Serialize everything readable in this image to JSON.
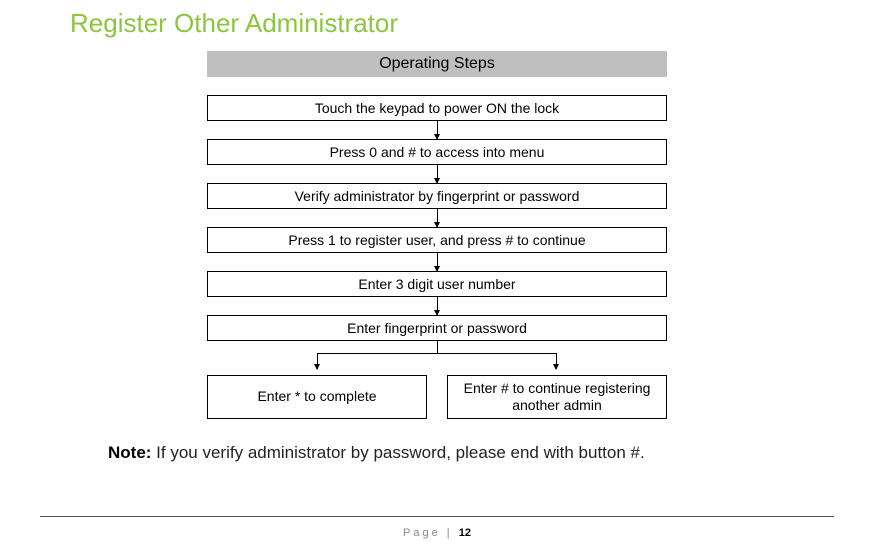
{
  "title": "Register Other Administrator",
  "header": "Operating Steps",
  "steps": [
    "Touch the keypad to power ON the lock",
    "Press  0 and  # to access into menu",
    "Verify administrator by fingerprint or password",
    "Press 1 to register user, and press # to continue",
    "Enter 3 digit user number",
    "Enter fingerprint or password"
  ],
  "branch_left": "Enter * to complete",
  "branch_right": "Enter # to continue registering another admin",
  "note_label": "Note:",
  "note_text": " If you verify administrator by password, please end with button #.",
  "footer_label": "Page",
  "footer_sep": " | ",
  "footer_page": "12"
}
